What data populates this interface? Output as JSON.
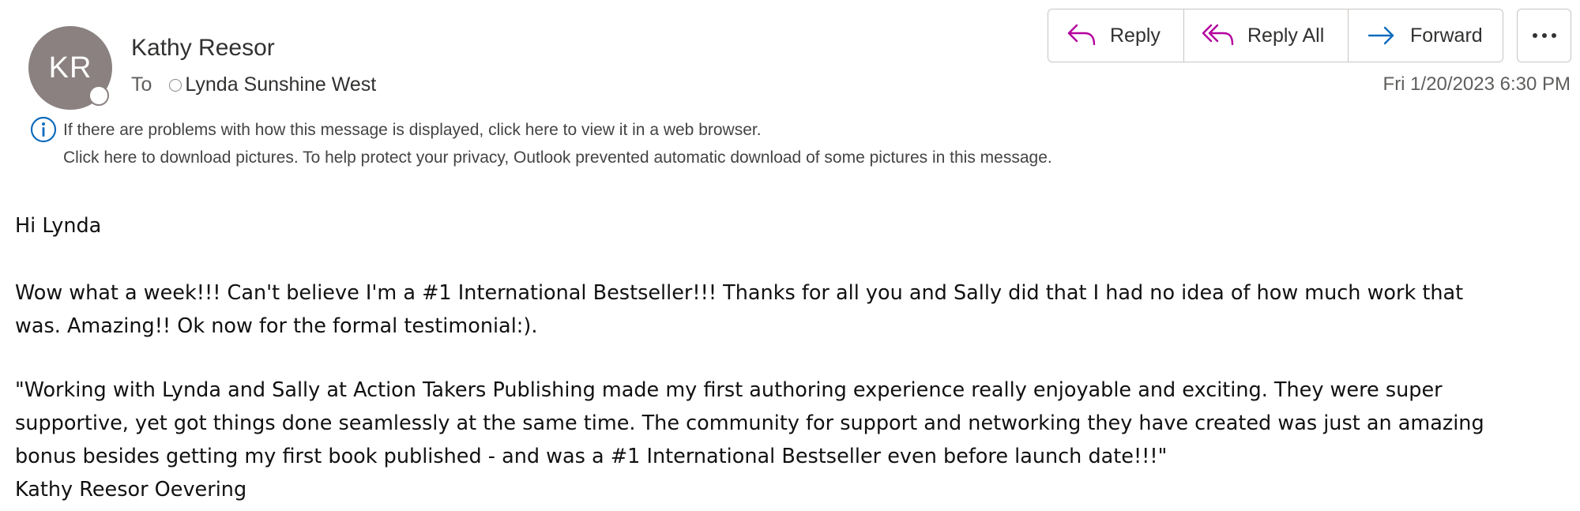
{
  "sender": {
    "initials": "KR",
    "name": "Kathy Reesor"
  },
  "recipients": {
    "to_label": "To",
    "to_name": "Lynda Sunshine West"
  },
  "actions": {
    "reply_label": "Reply",
    "reply_all_label": "Reply All",
    "forward_label": "Forward",
    "more_icon": "ellipsis-icon"
  },
  "timestamp": "Fri 1/20/2023 6:30 PM",
  "info_bar": {
    "icon": "info-icon",
    "line1": "If there are problems with how this message is displayed, click here to view it in a web browser.",
    "line2": "Click here to download pictures. To help protect your privacy, Outlook prevented automatic download of some pictures in this message."
  },
  "message_body": {
    "greeting": "Hi Lynda",
    "para1_line1": "Wow what a week!!! Can't believe I'm a #1 International Bestseller!!!  Thanks for all you and Sally did that I had no idea of how much work that",
    "para1_line2": "was.  Amazing!!  Ok now for the formal testimonial:).",
    "para2_line1": "\"Working with Lynda and Sally at Action Takers Publishing made my first authoring experience really enjoyable and exciting.  They were super",
    "para2_line2": "supportive, yet got things done seamlessly at the same time.  The community for support and networking they have created was just an amazing",
    "para2_line3": "bonus besides getting my first book published  - and was a #1 International Bestseller even before launch date!!!\"",
    "signature": "Kathy Reesor Oevering"
  },
  "colors": {
    "avatar_bg": "#8a8180",
    "reply_icon": "#b4009e",
    "forward_icon": "#0f6cbd",
    "info_icon": "#0f6cbd"
  }
}
